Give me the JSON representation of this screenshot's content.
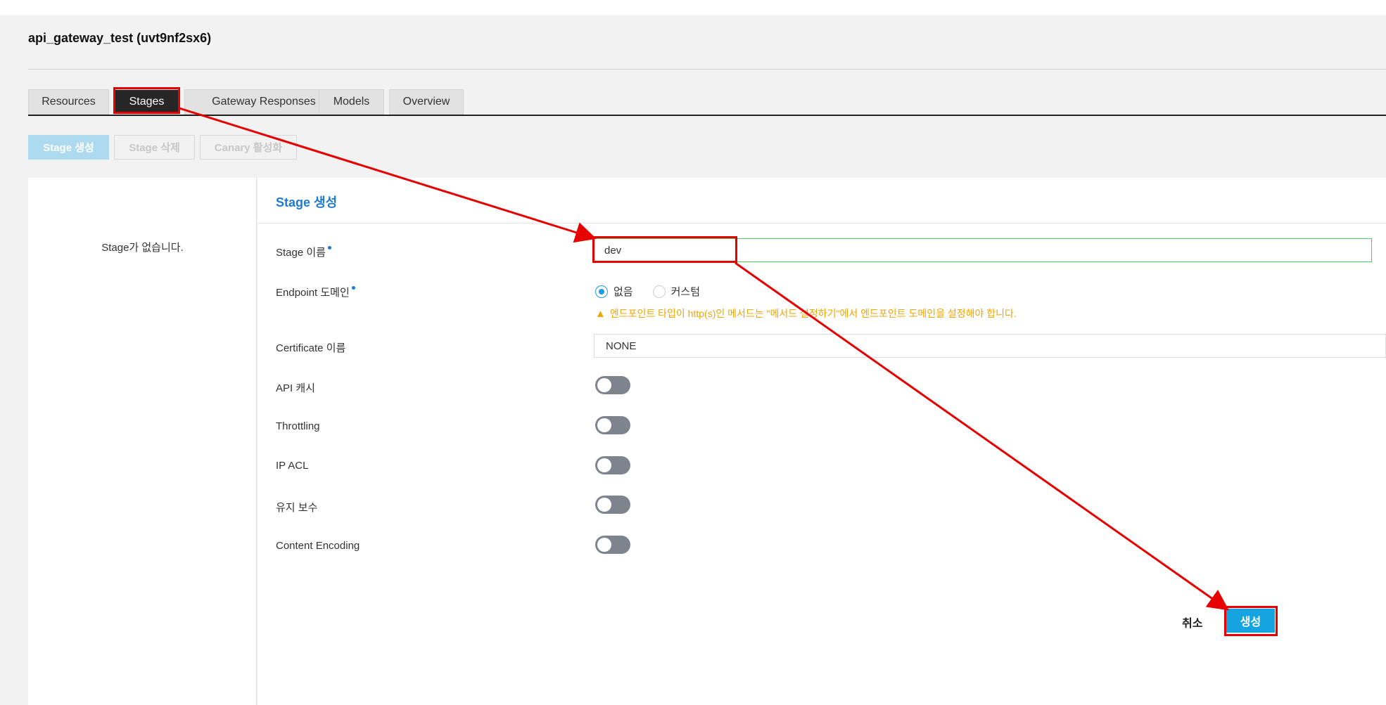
{
  "header": {
    "api_title": "api_gateway_test (uvt9nf2sx6)"
  },
  "tabs": [
    {
      "label": "Resources"
    },
    {
      "label": "Stages"
    },
    {
      "label": "Gateway Responses"
    },
    {
      "label": "Models"
    },
    {
      "label": "Overview"
    }
  ],
  "toolbar": {
    "create_stage": "Stage 생성",
    "delete_stage": "Stage 삭제",
    "canary": "Canary 활성화"
  },
  "left_panel": {
    "empty_message": "Stage가 없습니다."
  },
  "form": {
    "title": "Stage 생성",
    "stage_name_label": "Stage 이름",
    "stage_name_value": "dev",
    "endpoint_domain_label": "Endpoint 도메인",
    "radio_options": [
      "없음",
      "커스텀"
    ],
    "warning": "엔드포인트 타입이 http(s)인 메서드는 \"메서드 설정하기\"에서 엔드포인트 도메인을 설정해야 합니다.",
    "certificate_label": "Certificate 이름",
    "certificate_value": "NONE",
    "toggles": [
      {
        "label": "API 캐시",
        "on": false
      },
      {
        "label": "Throttling",
        "on": false
      },
      {
        "label": "IP ACL",
        "on": false
      },
      {
        "label": "유지 보수",
        "on": false
      },
      {
        "label": "Content Encoding",
        "on": false
      }
    ]
  },
  "footer": {
    "cancel": "취소",
    "create": "생성"
  },
  "colors": {
    "accent": "#1e7ad1",
    "primary_button": "#16a4e0",
    "warning": "#f0a500",
    "annotation": "#e60000",
    "valid_border": "#4cc76a"
  }
}
